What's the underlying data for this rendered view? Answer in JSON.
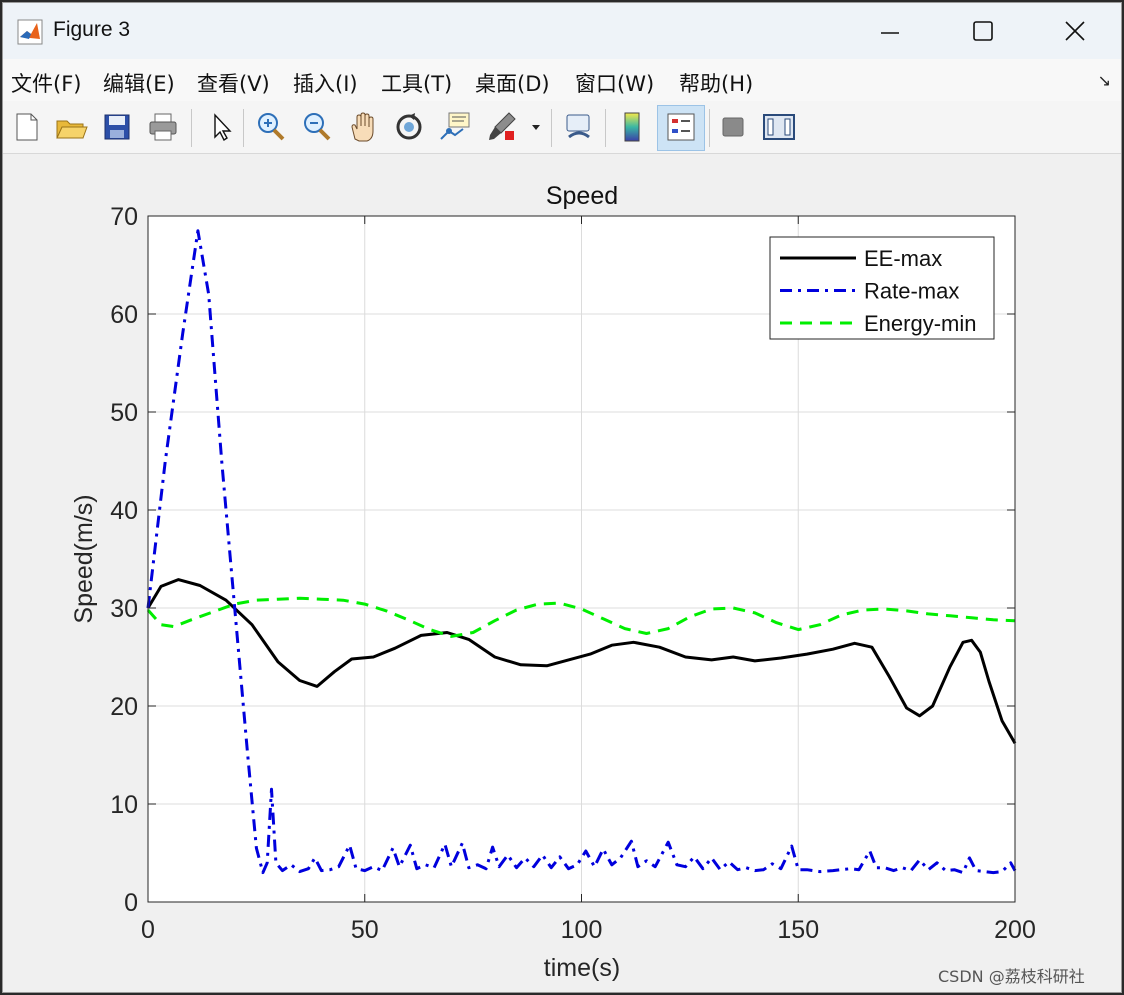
{
  "window": {
    "title": "Figure 3"
  },
  "menu": [
    "文件(F)",
    "编辑(E)",
    "查看(V)",
    "插入(I)",
    "工具(T)",
    "桌面(D)",
    "窗口(W)",
    "帮助(H)"
  ],
  "menu_arrow": "↘",
  "toolbar_icons": [
    "new-figure-icon",
    "open-icon",
    "save-icon",
    "print-icon",
    "pointer-icon",
    "zoom-in-icon",
    "zoom-out-icon",
    "pan-icon",
    "rotate-3d-icon",
    "data-cursor-icon",
    "brush-icon",
    "link-plot-icon",
    "colorbar-icon",
    "legend-icon",
    "hide-plot-tools-icon",
    "show-plot-tools-icon"
  ],
  "watermark": "CSDN @荔枝科研社",
  "chart_data": {
    "type": "line",
    "title": "Speed",
    "xlabel": "time(s)",
    "ylabel": "Speed(m/s)",
    "xlim": [
      0,
      200
    ],
    "ylim": [
      0,
      70
    ],
    "xticks": [
      0,
      50,
      100,
      150,
      200
    ],
    "yticks": [
      0,
      10,
      20,
      30,
      40,
      50,
      60,
      70
    ],
    "grid": true,
    "legend_position": "top-right",
    "series": [
      {
        "name": "EE-max",
        "color": "#000000",
        "style": "solid",
        "x": [
          0,
          3,
          7,
          12,
          18,
          24,
          30,
          35,
          39,
          43,
          47,
          52,
          57,
          63,
          69,
          74,
          80,
          86,
          92,
          97,
          102,
          107,
          112,
          118,
          124,
          130,
          135,
          140,
          146,
          152,
          158,
          163,
          167,
          171,
          175,
          178,
          181,
          185,
          188,
          190,
          192,
          194,
          197,
          200
        ],
        "y": [
          30,
          32.2,
          32.9,
          32.3,
          30.8,
          28.3,
          24.5,
          22.6,
          22.0,
          23.5,
          24.8,
          25.0,
          25.9,
          27.2,
          27.5,
          26.8,
          25.0,
          24.2,
          24.1,
          24.7,
          25.3,
          26.2,
          26.5,
          26.0,
          25.0,
          24.7,
          25.0,
          24.6,
          24.9,
          25.3,
          25.8,
          26.4,
          26.0,
          23.0,
          19.8,
          19.0,
          20.0,
          24.0,
          26.5,
          26.7,
          25.5,
          22.5,
          18.5,
          16.2
        ]
      },
      {
        "name": "Rate-max",
        "color": "#0000dd",
        "style": "dashdot",
        "x": [
          0,
          4,
          8,
          11.5,
          14,
          17,
          20,
          23,
          25,
          26.5,
          27.5,
          28.5,
          29.5,
          31,
          33,
          35,
          37,
          38.5,
          40,
          42,
          44,
          46.5,
          48,
          50,
          52,
          54,
          56.5,
          58,
          60.5,
          62,
          64,
          66,
          68.5,
          70,
          72.5,
          74,
          76,
          78,
          79.5,
          81,
          83,
          85,
          87,
          89,
          91,
          93,
          95,
          97,
          99,
          101,
          103,
          105,
          107,
          109,
          111.5,
          113,
          115,
          117,
          120,
          122,
          124,
          126,
          128,
          130,
          132,
          134,
          136,
          138,
          140,
          142,
          144,
          146,
          148.5,
          150,
          152,
          155,
          158,
          162,
          164,
          166.5,
          168,
          170,
          172,
          174,
          176,
          178,
          180,
          182,
          184,
          186,
          188,
          189.5,
          191,
          193,
          195,
          197,
          199,
          200
        ],
        "y": [
          30,
          45,
          58,
          68.5,
          62,
          45,
          30,
          15,
          5.5,
          3.0,
          4.0,
          11.5,
          4.0,
          3.2,
          3.8,
          3.1,
          3.4,
          4.5,
          3.2,
          3.3,
          3.6,
          5.8,
          3.4,
          3.2,
          3.6,
          3.2,
          5.5,
          3.6,
          5.8,
          3.4,
          3.8,
          3.5,
          5.9,
          3.6,
          6.0,
          3.5,
          3.8,
          3.4,
          5.6,
          3.6,
          4.8,
          3.5,
          4.5,
          3.6,
          4.8,
          3.5,
          4.6,
          3.4,
          3.8,
          5.2,
          3.6,
          5.4,
          3.8,
          4.5,
          6.2,
          3.6,
          4.2,
          3.6,
          6.1,
          3.8,
          3.6,
          4.6,
          3.4,
          4.5,
          3.3,
          4.1,
          3.3,
          3.5,
          3.2,
          3.3,
          3.9,
          3.4,
          5.7,
          3.3,
          3.3,
          3.1,
          3.2,
          3.4,
          3.3,
          5.2,
          3.5,
          3.5,
          3.2,
          3.5,
          3.2,
          4.3,
          3.3,
          4.0,
          3.2,
          3.3,
          3.0,
          4.5,
          3.2,
          3.1,
          3.0,
          3.1,
          4.0,
          3.2
        ]
      },
      {
        "name": "Energy-min",
        "color": "#00ee00",
        "style": "dashed",
        "x": [
          0,
          3,
          6,
          10,
          15,
          20,
          25,
          30,
          35,
          40,
          45,
          50,
          55,
          60,
          65,
          70,
          75,
          80,
          85,
          90,
          95,
          100,
          105,
          110,
          115,
          120,
          125,
          130,
          135,
          140,
          145,
          150,
          155,
          160,
          165,
          170,
          175,
          180,
          185,
          190,
          195,
          200
        ],
        "y": [
          29.8,
          28.3,
          28.1,
          28.8,
          29.6,
          30.4,
          30.8,
          30.9,
          31.0,
          30.9,
          30.8,
          30.4,
          29.7,
          28.8,
          27.8,
          27.1,
          27.5,
          28.7,
          29.8,
          30.4,
          30.5,
          29.9,
          28.9,
          27.9,
          27.4,
          27.9,
          29.1,
          29.9,
          30.0,
          29.5,
          28.5,
          27.8,
          28.3,
          29.3,
          29.8,
          29.9,
          29.7,
          29.4,
          29.2,
          29.0,
          28.8,
          28.7
        ]
      }
    ]
  }
}
